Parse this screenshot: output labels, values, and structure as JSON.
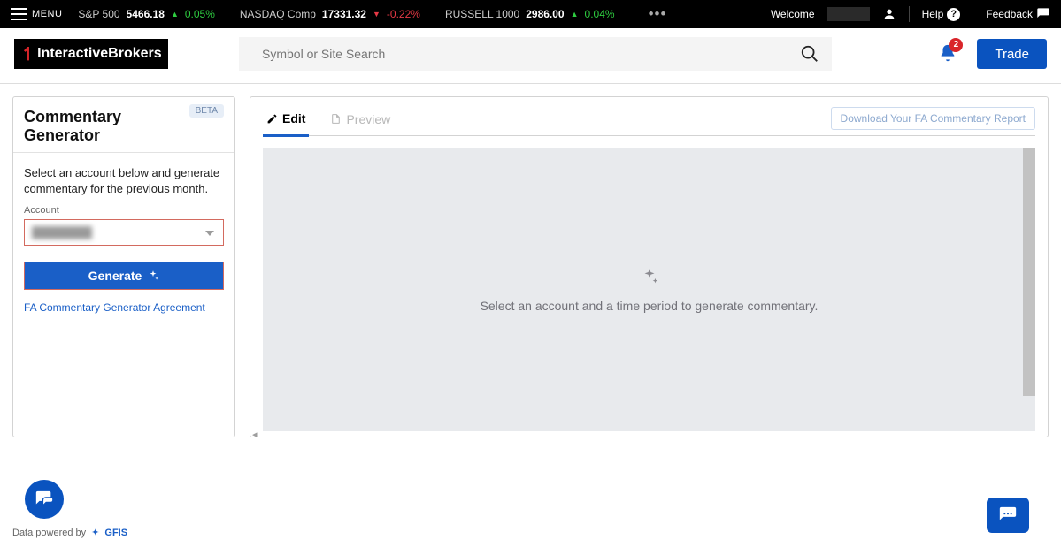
{
  "topbar": {
    "menu_label": "MENU",
    "tickers": [
      {
        "name": "S&P 500",
        "price": "5466.18",
        "arrow": "▲",
        "change": "0.05%",
        "dir": "up"
      },
      {
        "name": "NASDAQ Comp",
        "price": "17331.32",
        "arrow": "▼",
        "change": "-0.22%",
        "dir": "down"
      },
      {
        "name": "RUSSELL 1000",
        "price": "2986.00",
        "arrow": "▲",
        "change": "0.04%",
        "dir": "up"
      }
    ],
    "more": "•••",
    "welcome": "Welcome",
    "help": "Help",
    "feedback": "Feedback"
  },
  "header": {
    "logo_text_1": "Interactive",
    "logo_text_2": "Brokers",
    "search_placeholder": "Symbol or Site Search",
    "bell_badge": "2",
    "trade_label": "Trade"
  },
  "sidebar": {
    "title": "Commentary Generator",
    "beta": "BETA",
    "description": "Select an account below and generate commentary for the previous month.",
    "account_label": "Account",
    "account_placeholder": "████████",
    "generate_label": "Generate",
    "agreement_link": "FA Commentary Generator Agreement"
  },
  "content": {
    "tab_edit": "Edit",
    "tab_preview": "Preview",
    "download_label": "Download Your FA Commentary Report",
    "empty_message": "Select an account and a time period to generate commentary."
  },
  "footer": {
    "powered": "Data powered by",
    "gfis": "GFIS"
  }
}
